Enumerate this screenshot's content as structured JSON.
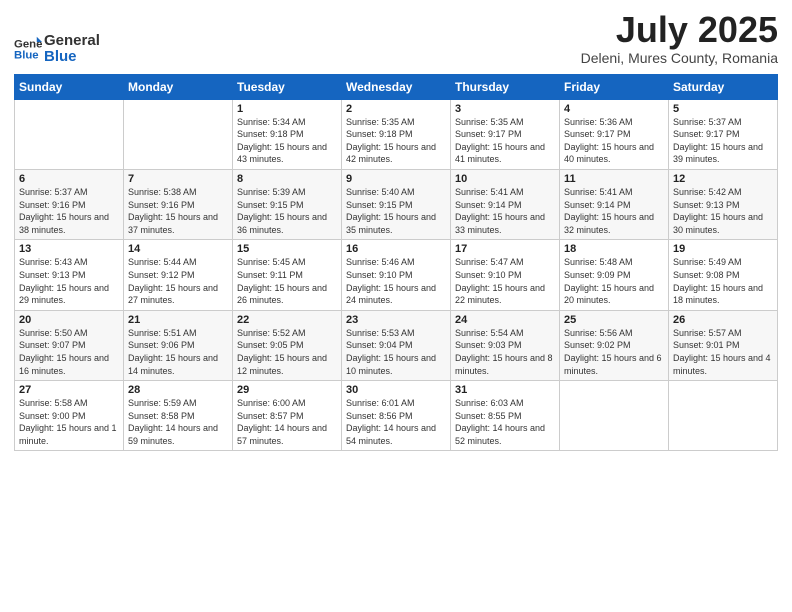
{
  "logo": {
    "text_general": "General",
    "text_blue": "Blue"
  },
  "header": {
    "month": "July 2025",
    "location": "Deleni, Mures County, Romania"
  },
  "weekdays": [
    "Sunday",
    "Monday",
    "Tuesday",
    "Wednesday",
    "Thursday",
    "Friday",
    "Saturday"
  ],
  "weeks": [
    [
      {
        "day": "",
        "sunrise": "",
        "sunset": "",
        "daylight": ""
      },
      {
        "day": "",
        "sunrise": "",
        "sunset": "",
        "daylight": ""
      },
      {
        "day": "1",
        "sunrise": "Sunrise: 5:34 AM",
        "sunset": "Sunset: 9:18 PM",
        "daylight": "Daylight: 15 hours and 43 minutes."
      },
      {
        "day": "2",
        "sunrise": "Sunrise: 5:35 AM",
        "sunset": "Sunset: 9:18 PM",
        "daylight": "Daylight: 15 hours and 42 minutes."
      },
      {
        "day": "3",
        "sunrise": "Sunrise: 5:35 AM",
        "sunset": "Sunset: 9:17 PM",
        "daylight": "Daylight: 15 hours and 41 minutes."
      },
      {
        "day": "4",
        "sunrise": "Sunrise: 5:36 AM",
        "sunset": "Sunset: 9:17 PM",
        "daylight": "Daylight: 15 hours and 40 minutes."
      },
      {
        "day": "5",
        "sunrise": "Sunrise: 5:37 AM",
        "sunset": "Sunset: 9:17 PM",
        "daylight": "Daylight: 15 hours and 39 minutes."
      }
    ],
    [
      {
        "day": "6",
        "sunrise": "Sunrise: 5:37 AM",
        "sunset": "Sunset: 9:16 PM",
        "daylight": "Daylight: 15 hours and 38 minutes."
      },
      {
        "day": "7",
        "sunrise": "Sunrise: 5:38 AM",
        "sunset": "Sunset: 9:16 PM",
        "daylight": "Daylight: 15 hours and 37 minutes."
      },
      {
        "day": "8",
        "sunrise": "Sunrise: 5:39 AM",
        "sunset": "Sunset: 9:15 PM",
        "daylight": "Daylight: 15 hours and 36 minutes."
      },
      {
        "day": "9",
        "sunrise": "Sunrise: 5:40 AM",
        "sunset": "Sunset: 9:15 PM",
        "daylight": "Daylight: 15 hours and 35 minutes."
      },
      {
        "day": "10",
        "sunrise": "Sunrise: 5:41 AM",
        "sunset": "Sunset: 9:14 PM",
        "daylight": "Daylight: 15 hours and 33 minutes."
      },
      {
        "day": "11",
        "sunrise": "Sunrise: 5:41 AM",
        "sunset": "Sunset: 9:14 PM",
        "daylight": "Daylight: 15 hours and 32 minutes."
      },
      {
        "day": "12",
        "sunrise": "Sunrise: 5:42 AM",
        "sunset": "Sunset: 9:13 PM",
        "daylight": "Daylight: 15 hours and 30 minutes."
      }
    ],
    [
      {
        "day": "13",
        "sunrise": "Sunrise: 5:43 AM",
        "sunset": "Sunset: 9:13 PM",
        "daylight": "Daylight: 15 hours and 29 minutes."
      },
      {
        "day": "14",
        "sunrise": "Sunrise: 5:44 AM",
        "sunset": "Sunset: 9:12 PM",
        "daylight": "Daylight: 15 hours and 27 minutes."
      },
      {
        "day": "15",
        "sunrise": "Sunrise: 5:45 AM",
        "sunset": "Sunset: 9:11 PM",
        "daylight": "Daylight: 15 hours and 26 minutes."
      },
      {
        "day": "16",
        "sunrise": "Sunrise: 5:46 AM",
        "sunset": "Sunset: 9:10 PM",
        "daylight": "Daylight: 15 hours and 24 minutes."
      },
      {
        "day": "17",
        "sunrise": "Sunrise: 5:47 AM",
        "sunset": "Sunset: 9:10 PM",
        "daylight": "Daylight: 15 hours and 22 minutes."
      },
      {
        "day": "18",
        "sunrise": "Sunrise: 5:48 AM",
        "sunset": "Sunset: 9:09 PM",
        "daylight": "Daylight: 15 hours and 20 minutes."
      },
      {
        "day": "19",
        "sunrise": "Sunrise: 5:49 AM",
        "sunset": "Sunset: 9:08 PM",
        "daylight": "Daylight: 15 hours and 18 minutes."
      }
    ],
    [
      {
        "day": "20",
        "sunrise": "Sunrise: 5:50 AM",
        "sunset": "Sunset: 9:07 PM",
        "daylight": "Daylight: 15 hours and 16 minutes."
      },
      {
        "day": "21",
        "sunrise": "Sunrise: 5:51 AM",
        "sunset": "Sunset: 9:06 PM",
        "daylight": "Daylight: 15 hours and 14 minutes."
      },
      {
        "day": "22",
        "sunrise": "Sunrise: 5:52 AM",
        "sunset": "Sunset: 9:05 PM",
        "daylight": "Daylight: 15 hours and 12 minutes."
      },
      {
        "day": "23",
        "sunrise": "Sunrise: 5:53 AM",
        "sunset": "Sunset: 9:04 PM",
        "daylight": "Daylight: 15 hours and 10 minutes."
      },
      {
        "day": "24",
        "sunrise": "Sunrise: 5:54 AM",
        "sunset": "Sunset: 9:03 PM",
        "daylight": "Daylight: 15 hours and 8 minutes."
      },
      {
        "day": "25",
        "sunrise": "Sunrise: 5:56 AM",
        "sunset": "Sunset: 9:02 PM",
        "daylight": "Daylight: 15 hours and 6 minutes."
      },
      {
        "day": "26",
        "sunrise": "Sunrise: 5:57 AM",
        "sunset": "Sunset: 9:01 PM",
        "daylight": "Daylight: 15 hours and 4 minutes."
      }
    ],
    [
      {
        "day": "27",
        "sunrise": "Sunrise: 5:58 AM",
        "sunset": "Sunset: 9:00 PM",
        "daylight": "Daylight: 15 hours and 1 minute."
      },
      {
        "day": "28",
        "sunrise": "Sunrise: 5:59 AM",
        "sunset": "Sunset: 8:58 PM",
        "daylight": "Daylight: 14 hours and 59 minutes."
      },
      {
        "day": "29",
        "sunrise": "Sunrise: 6:00 AM",
        "sunset": "Sunset: 8:57 PM",
        "daylight": "Daylight: 14 hours and 57 minutes."
      },
      {
        "day": "30",
        "sunrise": "Sunrise: 6:01 AM",
        "sunset": "Sunset: 8:56 PM",
        "daylight": "Daylight: 14 hours and 54 minutes."
      },
      {
        "day": "31",
        "sunrise": "Sunrise: 6:03 AM",
        "sunset": "Sunset: 8:55 PM",
        "daylight": "Daylight: 14 hours and 52 minutes."
      },
      {
        "day": "",
        "sunrise": "",
        "sunset": "",
        "daylight": ""
      },
      {
        "day": "",
        "sunrise": "",
        "sunset": "",
        "daylight": ""
      }
    ]
  ]
}
